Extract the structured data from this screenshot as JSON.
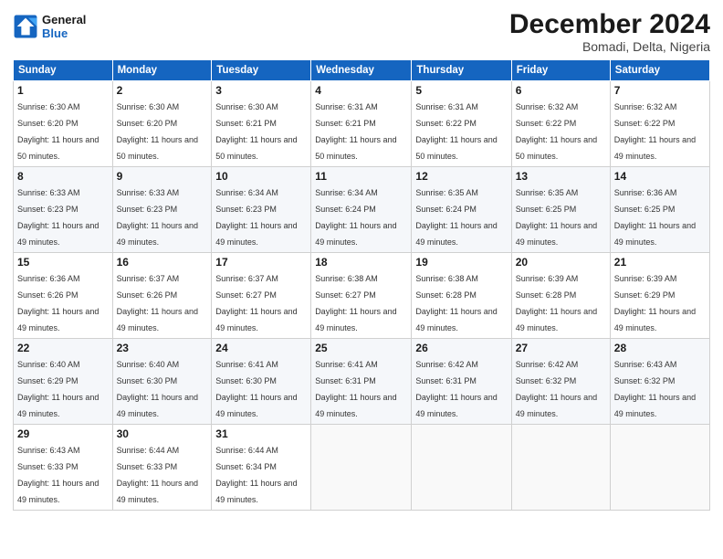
{
  "header": {
    "logo_line1": "General",
    "logo_line2": "Blue",
    "month": "December 2024",
    "location": "Bomadi, Delta, Nigeria"
  },
  "days_of_week": [
    "Sunday",
    "Monday",
    "Tuesday",
    "Wednesday",
    "Thursday",
    "Friday",
    "Saturday"
  ],
  "weeks": [
    [
      {
        "day": 1,
        "sunrise": "6:30 AM",
        "sunset": "6:20 PM",
        "daylight": "11 hours and 50 minutes."
      },
      {
        "day": 2,
        "sunrise": "6:30 AM",
        "sunset": "6:20 PM",
        "daylight": "11 hours and 50 minutes."
      },
      {
        "day": 3,
        "sunrise": "6:30 AM",
        "sunset": "6:21 PM",
        "daylight": "11 hours and 50 minutes."
      },
      {
        "day": 4,
        "sunrise": "6:31 AM",
        "sunset": "6:21 PM",
        "daylight": "11 hours and 50 minutes."
      },
      {
        "day": 5,
        "sunrise": "6:31 AM",
        "sunset": "6:22 PM",
        "daylight": "11 hours and 50 minutes."
      },
      {
        "day": 6,
        "sunrise": "6:32 AM",
        "sunset": "6:22 PM",
        "daylight": "11 hours and 50 minutes."
      },
      {
        "day": 7,
        "sunrise": "6:32 AM",
        "sunset": "6:22 PM",
        "daylight": "11 hours and 49 minutes."
      }
    ],
    [
      {
        "day": 8,
        "sunrise": "6:33 AM",
        "sunset": "6:23 PM",
        "daylight": "11 hours and 49 minutes."
      },
      {
        "day": 9,
        "sunrise": "6:33 AM",
        "sunset": "6:23 PM",
        "daylight": "11 hours and 49 minutes."
      },
      {
        "day": 10,
        "sunrise": "6:34 AM",
        "sunset": "6:23 PM",
        "daylight": "11 hours and 49 minutes."
      },
      {
        "day": 11,
        "sunrise": "6:34 AM",
        "sunset": "6:24 PM",
        "daylight": "11 hours and 49 minutes."
      },
      {
        "day": 12,
        "sunrise": "6:35 AM",
        "sunset": "6:24 PM",
        "daylight": "11 hours and 49 minutes."
      },
      {
        "day": 13,
        "sunrise": "6:35 AM",
        "sunset": "6:25 PM",
        "daylight": "11 hours and 49 minutes."
      },
      {
        "day": 14,
        "sunrise": "6:36 AM",
        "sunset": "6:25 PM",
        "daylight": "11 hours and 49 minutes."
      }
    ],
    [
      {
        "day": 15,
        "sunrise": "6:36 AM",
        "sunset": "6:26 PM",
        "daylight": "11 hours and 49 minutes."
      },
      {
        "day": 16,
        "sunrise": "6:37 AM",
        "sunset": "6:26 PM",
        "daylight": "11 hours and 49 minutes."
      },
      {
        "day": 17,
        "sunrise": "6:37 AM",
        "sunset": "6:27 PM",
        "daylight": "11 hours and 49 minutes."
      },
      {
        "day": 18,
        "sunrise": "6:38 AM",
        "sunset": "6:27 PM",
        "daylight": "11 hours and 49 minutes."
      },
      {
        "day": 19,
        "sunrise": "6:38 AM",
        "sunset": "6:28 PM",
        "daylight": "11 hours and 49 minutes."
      },
      {
        "day": 20,
        "sunrise": "6:39 AM",
        "sunset": "6:28 PM",
        "daylight": "11 hours and 49 minutes."
      },
      {
        "day": 21,
        "sunrise": "6:39 AM",
        "sunset": "6:29 PM",
        "daylight": "11 hours and 49 minutes."
      }
    ],
    [
      {
        "day": 22,
        "sunrise": "6:40 AM",
        "sunset": "6:29 PM",
        "daylight": "11 hours and 49 minutes."
      },
      {
        "day": 23,
        "sunrise": "6:40 AM",
        "sunset": "6:30 PM",
        "daylight": "11 hours and 49 minutes."
      },
      {
        "day": 24,
        "sunrise": "6:41 AM",
        "sunset": "6:30 PM",
        "daylight": "11 hours and 49 minutes."
      },
      {
        "day": 25,
        "sunrise": "6:41 AM",
        "sunset": "6:31 PM",
        "daylight": "11 hours and 49 minutes."
      },
      {
        "day": 26,
        "sunrise": "6:42 AM",
        "sunset": "6:31 PM",
        "daylight": "11 hours and 49 minutes."
      },
      {
        "day": 27,
        "sunrise": "6:42 AM",
        "sunset": "6:32 PM",
        "daylight": "11 hours and 49 minutes."
      },
      {
        "day": 28,
        "sunrise": "6:43 AM",
        "sunset": "6:32 PM",
        "daylight": "11 hours and 49 minutes."
      }
    ],
    [
      {
        "day": 29,
        "sunrise": "6:43 AM",
        "sunset": "6:33 PM",
        "daylight": "11 hours and 49 minutes."
      },
      {
        "day": 30,
        "sunrise": "6:44 AM",
        "sunset": "6:33 PM",
        "daylight": "11 hours and 49 minutes."
      },
      {
        "day": 31,
        "sunrise": "6:44 AM",
        "sunset": "6:34 PM",
        "daylight": "11 hours and 49 minutes."
      },
      null,
      null,
      null,
      null
    ]
  ]
}
